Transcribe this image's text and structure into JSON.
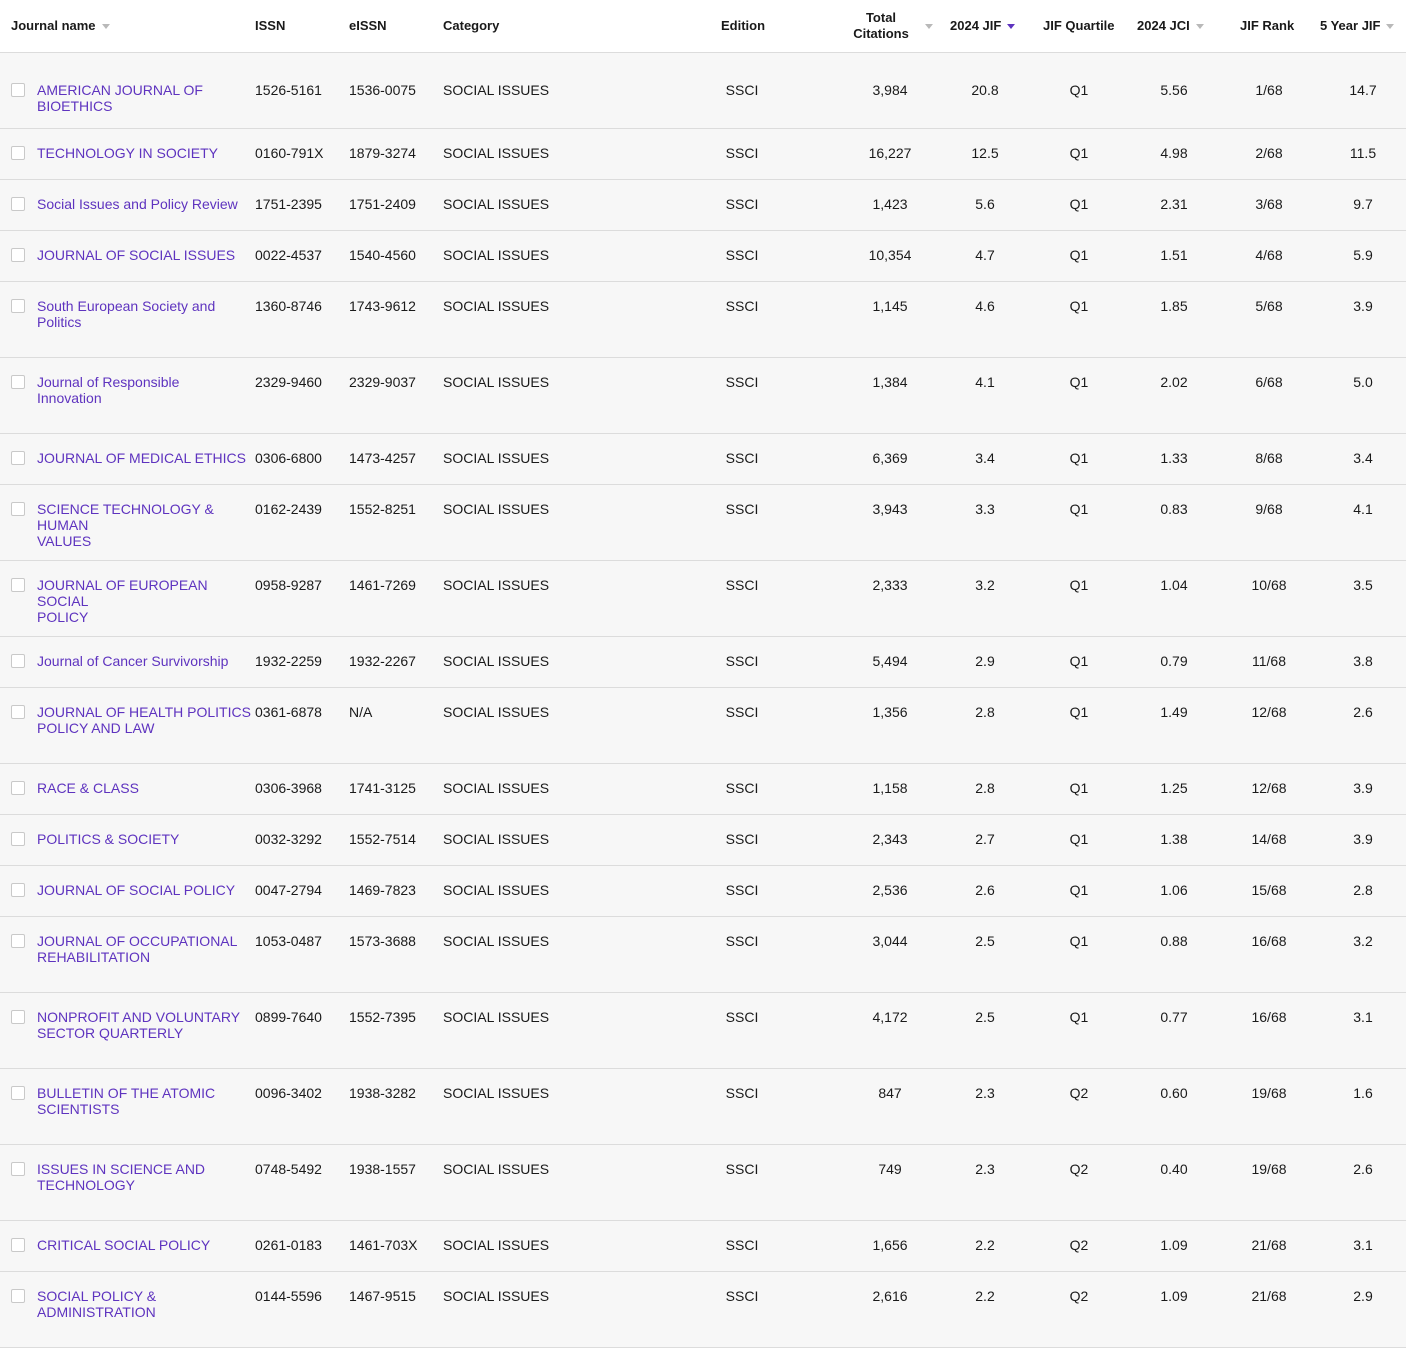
{
  "header": {
    "journal_name": "Journal name",
    "issn": "ISSN",
    "eissn": "eISSN",
    "category": "Category",
    "edition": "Edition",
    "total_citations_1": "Total",
    "total_citations_2": "Citations",
    "jif_2024": "2024 JIF",
    "jif_quartile": "JIF Quartile",
    "jci_2024": "2024 JCI",
    "jif_rank": "JIF Rank",
    "five_year_jif": "5 Year JIF"
  },
  "colors": {
    "link": "#5e33bf",
    "row_bg": "#f7f7f7",
    "border": "#dcdcdc"
  },
  "rows": [
    {
      "n1": "AMERICAN JOURNAL OF",
      "n2": "BIOETHICS",
      "issn": "1526-5161",
      "eissn": "1536-0075",
      "cat": "SOCIAL ISSUES",
      "ed": "SSCI",
      "cit": "3,984",
      "jif": "20.8",
      "q": "Q1",
      "jci": "5.56",
      "rank": "1/68",
      "y5": "14.7"
    },
    {
      "n1": "TECHNOLOGY IN SOCIETY",
      "n2": "",
      "issn": "0160-791X",
      "eissn": "1879-3274",
      "cat": "SOCIAL ISSUES",
      "ed": "SSCI",
      "cit": "16,227",
      "jif": "12.5",
      "q": "Q1",
      "jci": "4.98",
      "rank": "2/68",
      "y5": "11.5"
    },
    {
      "n1": "Social Issues and Policy Review",
      "n2": "",
      "issn": "1751-2395",
      "eissn": "1751-2409",
      "cat": "SOCIAL ISSUES",
      "ed": "SSCI",
      "cit": "1,423",
      "jif": "5.6",
      "q": "Q1",
      "jci": "2.31",
      "rank": "3/68",
      "y5": "9.7"
    },
    {
      "n1": "JOURNAL OF SOCIAL ISSUES",
      "n2": "",
      "issn": "0022-4537",
      "eissn": "1540-4560",
      "cat": "SOCIAL ISSUES",
      "ed": "SSCI",
      "cit": "10,354",
      "jif": "4.7",
      "q": "Q1",
      "jci": "1.51",
      "rank": "4/68",
      "y5": "5.9"
    },
    {
      "n1": "South European Society and",
      "n2": "Politics",
      "issn": "1360-8746",
      "eissn": "1743-9612",
      "cat": "SOCIAL ISSUES",
      "ed": "SSCI",
      "cit": "1,145",
      "jif": "4.6",
      "q": "Q1",
      "jci": "1.85",
      "rank": "5/68",
      "y5": "3.9"
    },
    {
      "n1": "Journal of Responsible",
      "n2": "Innovation",
      "issn": "2329-9460",
      "eissn": "2329-9037",
      "cat": "SOCIAL ISSUES",
      "ed": "SSCI",
      "cit": "1,384",
      "jif": "4.1",
      "q": "Q1",
      "jci": "2.02",
      "rank": "6/68",
      "y5": "5.0"
    },
    {
      "n1": "JOURNAL OF MEDICAL ETHICS",
      "n2": "",
      "issn": "0306-6800",
      "eissn": "1473-4257",
      "cat": "SOCIAL ISSUES",
      "ed": "SSCI",
      "cit": "6,369",
      "jif": "3.4",
      "q": "Q1",
      "jci": "1.33",
      "rank": "8/68",
      "y5": "3.4"
    },
    {
      "n1": "SCIENCE TECHNOLOGY & HUMAN",
      "n2": "VALUES",
      "issn": "0162-2439",
      "eissn": "1552-8251",
      "cat": "SOCIAL ISSUES",
      "ed": "SSCI",
      "cit": "3,943",
      "jif": "3.3",
      "q": "Q1",
      "jci": "0.83",
      "rank": "9/68",
      "y5": "4.1"
    },
    {
      "n1": "JOURNAL OF EUROPEAN SOCIAL",
      "n2": "POLICY",
      "issn": "0958-9287",
      "eissn": "1461-7269",
      "cat": "SOCIAL ISSUES",
      "ed": "SSCI",
      "cit": "2,333",
      "jif": "3.2",
      "q": "Q1",
      "jci": "1.04",
      "rank": "10/68",
      "y5": "3.5"
    },
    {
      "n1": "Journal of Cancer Survivorship",
      "n2": "",
      "issn": "1932-2259",
      "eissn": "1932-2267",
      "cat": "SOCIAL ISSUES",
      "ed": "SSCI",
      "cit": "5,494",
      "jif": "2.9",
      "q": "Q1",
      "jci": "0.79",
      "rank": "11/68",
      "y5": "3.8"
    },
    {
      "n1": "JOURNAL OF HEALTH POLITICS",
      "n2": "POLICY AND LAW",
      "issn": "0361-6878",
      "eissn": "N/A",
      "cat": "SOCIAL ISSUES",
      "ed": "SSCI",
      "cit": "1,356",
      "jif": "2.8",
      "q": "Q1",
      "jci": "1.49",
      "rank": "12/68",
      "y5": "2.6"
    },
    {
      "n1": "RACE & CLASS",
      "n2": "",
      "issn": "0306-3968",
      "eissn": "1741-3125",
      "cat": "SOCIAL ISSUES",
      "ed": "SSCI",
      "cit": "1,158",
      "jif": "2.8",
      "q": "Q1",
      "jci": "1.25",
      "rank": "12/68",
      "y5": "3.9"
    },
    {
      "n1": "POLITICS & SOCIETY",
      "n2": "",
      "issn": "0032-3292",
      "eissn": "1552-7514",
      "cat": "SOCIAL ISSUES",
      "ed": "SSCI",
      "cit": "2,343",
      "jif": "2.7",
      "q": "Q1",
      "jci": "1.38",
      "rank": "14/68",
      "y5": "3.9"
    },
    {
      "n1": "JOURNAL OF SOCIAL POLICY",
      "n2": "",
      "issn": "0047-2794",
      "eissn": "1469-7823",
      "cat": "SOCIAL ISSUES",
      "ed": "SSCI",
      "cit": "2,536",
      "jif": "2.6",
      "q": "Q1",
      "jci": "1.06",
      "rank": "15/68",
      "y5": "2.8"
    },
    {
      "n1": "JOURNAL OF OCCUPATIONAL",
      "n2": "REHABILITATION",
      "issn": "1053-0487",
      "eissn": "1573-3688",
      "cat": "SOCIAL ISSUES",
      "ed": "SSCI",
      "cit": "3,044",
      "jif": "2.5",
      "q": "Q1",
      "jci": "0.88",
      "rank": "16/68",
      "y5": "3.2"
    },
    {
      "n1": "NONPROFIT AND VOLUNTARY",
      "n2": "SECTOR QUARTERLY",
      "issn": "0899-7640",
      "eissn": "1552-7395",
      "cat": "SOCIAL ISSUES",
      "ed": "SSCI",
      "cit": "4,172",
      "jif": "2.5",
      "q": "Q1",
      "jci": "0.77",
      "rank": "16/68",
      "y5": "3.1"
    },
    {
      "n1": "BULLETIN OF THE ATOMIC",
      "n2": "SCIENTISTS",
      "issn": "0096-3402",
      "eissn": "1938-3282",
      "cat": "SOCIAL ISSUES",
      "ed": "SSCI",
      "cit": "847",
      "jif": "2.3",
      "q": "Q2",
      "jci": "0.60",
      "rank": "19/68",
      "y5": "1.6"
    },
    {
      "n1": "ISSUES IN SCIENCE AND",
      "n2": "TECHNOLOGY",
      "issn": "0748-5492",
      "eissn": "1938-1557",
      "cat": "SOCIAL ISSUES",
      "ed": "SSCI",
      "cit": "749",
      "jif": "2.3",
      "q": "Q2",
      "jci": "0.40",
      "rank": "19/68",
      "y5": "2.6"
    },
    {
      "n1": "CRITICAL SOCIAL POLICY",
      "n2": "",
      "issn": "0261-0183",
      "eissn": "1461-703X",
      "cat": "SOCIAL ISSUES",
      "ed": "SSCI",
      "cit": "1,656",
      "jif": "2.2",
      "q": "Q2",
      "jci": "1.09",
      "rank": "21/68",
      "y5": "3.1"
    },
    {
      "n1": "SOCIAL POLICY &",
      "n2": "ADMINISTRATION",
      "issn": "0144-5596",
      "eissn": "1467-9515",
      "cat": "SOCIAL ISSUES",
      "ed": "SSCI",
      "cit": "2,616",
      "jif": "2.2",
      "q": "Q2",
      "jci": "1.09",
      "rank": "21/68",
      "y5": "2.9"
    }
  ]
}
